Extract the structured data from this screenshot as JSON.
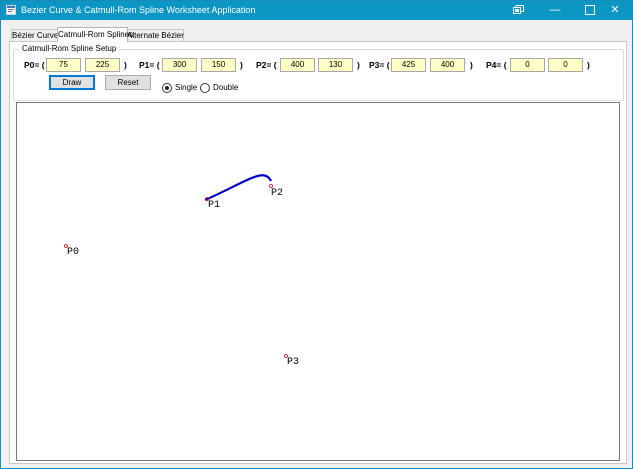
{
  "window": {
    "title": "Bezier Curve & Catmull-Rom Spline Worksheet Application",
    "minimize_glyph": "—",
    "close_glyph": "✕"
  },
  "tabs": [
    {
      "label": "Bézier Curves",
      "active": false
    },
    {
      "label": "Catmull-Rom Splines",
      "active": true
    },
    {
      "label": "Alternate Bézier",
      "active": false
    }
  ],
  "setup": {
    "legend": "Catmull-Rom Spline Setup",
    "points": [
      {
        "label": "P0= (",
        "x": "75",
        "y": "225",
        "close": ")"
      },
      {
        "label": "P1= (",
        "x": "300",
        "y": "150",
        "close": ")"
      },
      {
        "label": "P2= (",
        "x": "400",
        "y": "130",
        "close": ")"
      },
      {
        "label": "P3= (",
        "x": "425",
        "y": "400",
        "close": ")"
      },
      {
        "label": "P4= (",
        "x": "0",
        "y": "0",
        "close": ")"
      }
    ],
    "draw_label": "Draw",
    "reset_label": "Reset",
    "single_label": "Single",
    "double_label": "Double",
    "selected_mode": "Single"
  },
  "canvas": {
    "point_labels": [
      "P0",
      "P1",
      "P2",
      "P3"
    ],
    "curve_color": "#0000cc",
    "marker_color": "#cc0000"
  }
}
